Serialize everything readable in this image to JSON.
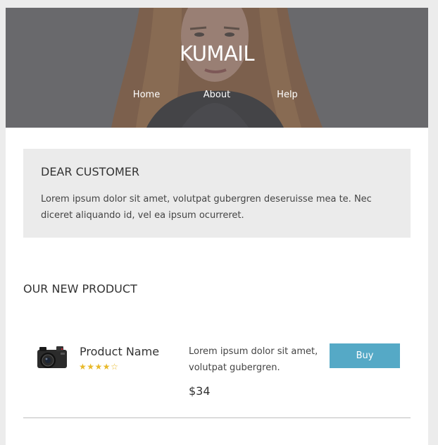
{
  "header": {
    "brand": "KUMAIL",
    "nav": [
      {
        "label": "Home"
      },
      {
        "label": "About"
      },
      {
        "label": "Help"
      }
    ]
  },
  "notice": {
    "title": "DEAR CUSTOMER",
    "text": "Lorem ipsum dolor sit amet, volutpat gubergren deseruisse mea te. Nec diceret aliquando id, vel ea ipsum ocurreret."
  },
  "products_section": {
    "title": "OUR NEW PRODUCT",
    "product": {
      "icon": "camera-icon",
      "name": "Product Name",
      "rating": 4,
      "rating_max": 5,
      "description": "Lorem ipsum dolor sit amet, volutpat gubergren.",
      "price": "$34",
      "buy_label": "Buy"
    }
  },
  "colors": {
    "page_background": "#ececec",
    "card_background": "#ffffff",
    "notice_background": "#ebebeb",
    "buy_button": "#55a9c6",
    "star": "#e8b92a",
    "hero_overlay": "#6a6a6c"
  }
}
